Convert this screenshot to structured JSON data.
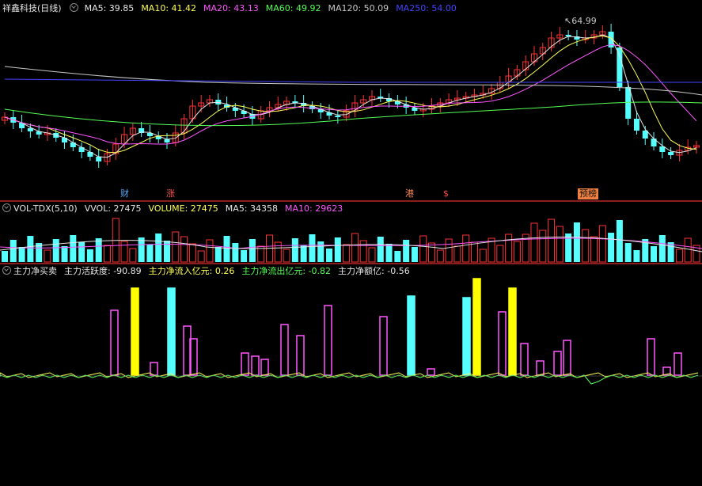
{
  "price_panel": {
    "name": "祥鑫科技(日线)",
    "indicators": [
      {
        "label": "MA5: 39.85",
        "color": "#e6e6e6"
      },
      {
        "label": "MA10: 41.42",
        "color": "#ffff55"
      },
      {
        "label": "MA20: 43.13",
        "color": "#ff55ff"
      },
      {
        "label": "MA60: 49.92",
        "color": "#55ff55"
      },
      {
        "label": "MA120: 50.09",
        "color": "#c8c8c8"
      },
      {
        "label": "MA250: 54.00",
        "color": "#4444ff"
      }
    ],
    "peak_label": "64.99",
    "event_tags": [
      {
        "text": "财",
        "color": "#55aaff",
        "bg": "transparent"
      },
      {
        "text": "涨",
        "color": "#ff5555",
        "bg": "transparent"
      },
      {
        "text": "港",
        "color": "#ff8855",
        "bg": "transparent"
      },
      {
        "text": "$",
        "color": "#ff4444",
        "bg": "transparent"
      },
      {
        "text": "预榜",
        "color": "#111111",
        "bg": "#f08040"
      }
    ]
  },
  "volume_panel": {
    "name": "VOL-TDX(5,10)",
    "indicators": [
      {
        "label": "VVOL: 27475",
        "color": "#e6e6e6"
      },
      {
        "label": "VOLUME: 27475",
        "color": "#ffff55"
      },
      {
        "label": "MA5: 34358",
        "color": "#e6e6e6"
      },
      {
        "label": "MA10: 29623",
        "color": "#ff55ff"
      }
    ]
  },
  "fund_panel": {
    "name": "主力净买卖",
    "indicators": [
      {
        "label": "主力活跃度: -90.89",
        "color": "#e6e6e6"
      },
      {
        "label": "主力净流入亿元: 0.26",
        "color": "#ffff55"
      },
      {
        "label": "主力净流出亿元: -0.82",
        "color": "#55ff55"
      },
      {
        "label": "主力净额亿: -0.56",
        "color": "#e6e6e6"
      }
    ]
  },
  "chart_data": {
    "type": "candlestick",
    "series": [
      {
        "name": "MA5",
        "color": "#e6e6e6"
      },
      {
        "name": "MA10",
        "color": "#ffff55"
      },
      {
        "name": "MA20",
        "color": "#ff55ff"
      },
      {
        "name": "MA60",
        "color": "#55ff55"
      },
      {
        "name": "MA120",
        "color": "#c8c8c8"
      },
      {
        "name": "MA250",
        "color": "#4444ff"
      }
    ],
    "colors": {
      "up": "#ff3333",
      "down": "#55ffff",
      "fund_bar": "#ff55ff",
      "fund_hi_yellow": "#ffff00",
      "fund_hi_cyan": "#55ffff"
    }
  }
}
